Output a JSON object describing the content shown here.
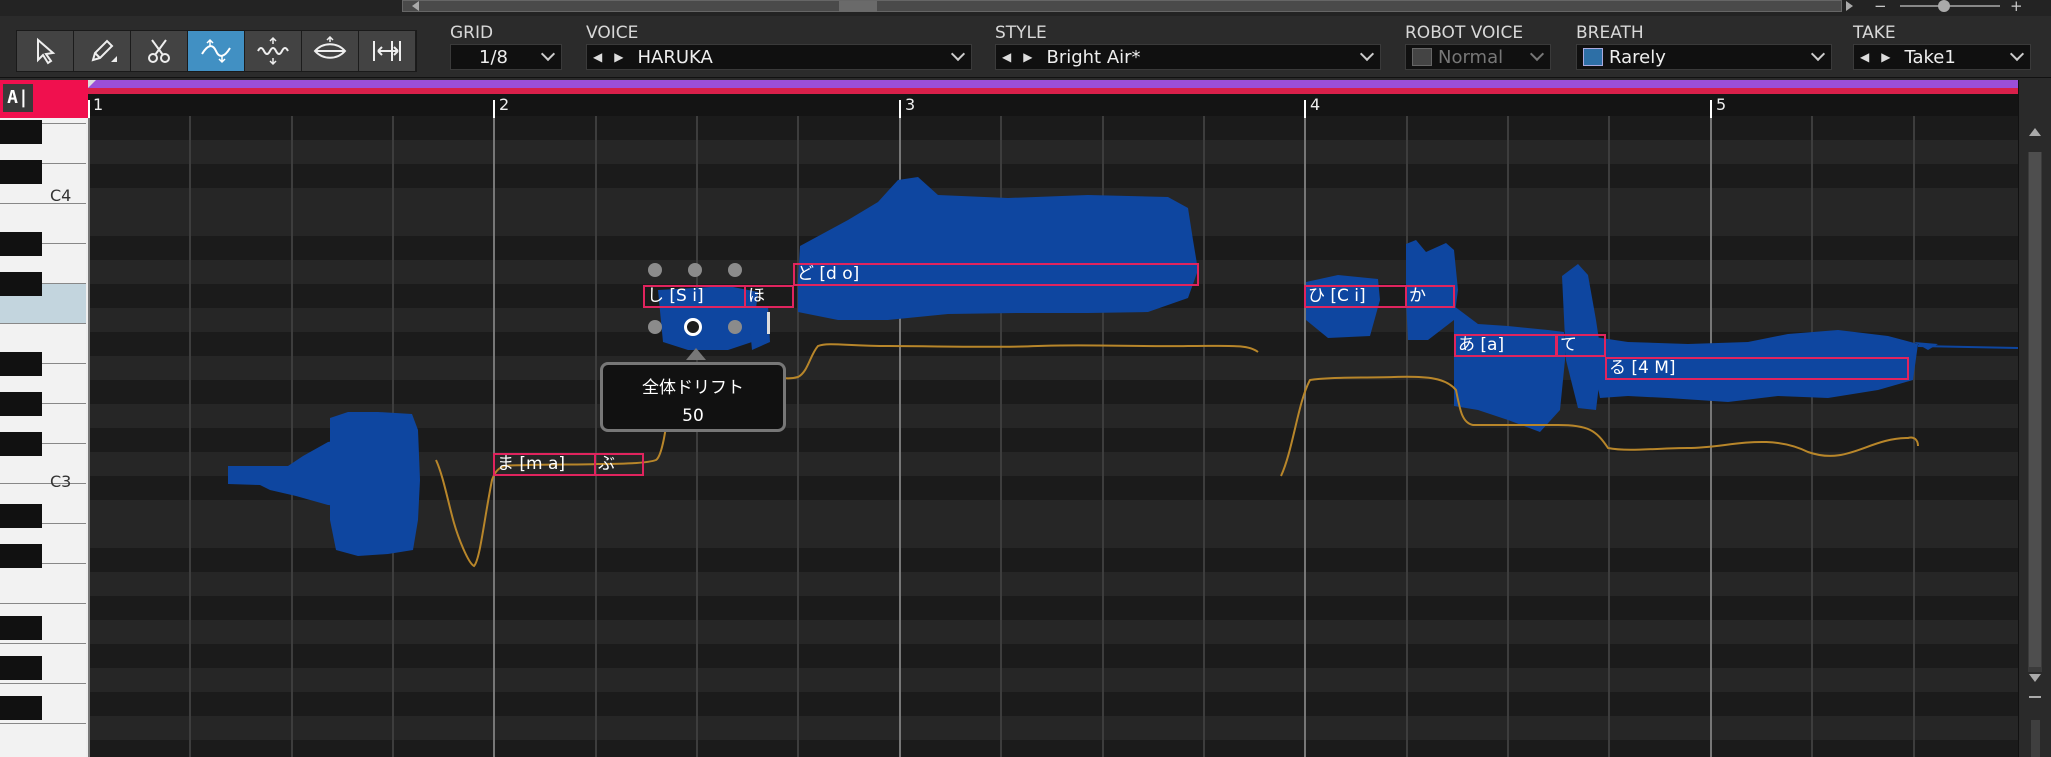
{
  "top_bar": {
    "zoom_minus": "−",
    "zoom_plus": "+"
  },
  "tools": [
    {
      "name": "pointer-tool",
      "icon": "arrow-cursor-icon",
      "active": false
    },
    {
      "name": "pencil-tool",
      "icon": "pencil-icon",
      "active": false
    },
    {
      "name": "scissors-tool",
      "icon": "scissors-icon",
      "active": false
    },
    {
      "name": "pitch-drift-tool",
      "icon": "pitch-drift-icon",
      "active": true
    },
    {
      "name": "vibrato-tool",
      "icon": "vibrato-icon",
      "active": false
    },
    {
      "name": "volume-tool",
      "icon": "volume-shape-icon",
      "active": false
    },
    {
      "name": "timing-tool",
      "icon": "timing-stretch-icon",
      "active": false
    }
  ],
  "fields": {
    "grid": {
      "label": "GRID",
      "value": "1/8"
    },
    "voice": {
      "label": "VOICE",
      "value": "HARUKA"
    },
    "style": {
      "label": "STYLE",
      "value": "Bright Air*"
    },
    "robot_voice": {
      "label": "ROBOT VOICE",
      "value": "Normal"
    },
    "breath": {
      "label": "BREATH",
      "value": "Rarely"
    },
    "take": {
      "label": "TAKE",
      "value": "Take1"
    }
  },
  "ai_badge": "A|",
  "piano_labels": {
    "c4": "C4",
    "c3": "C3"
  },
  "bars": [
    "1",
    "2",
    "3",
    "4",
    "5"
  ],
  "notes": [
    {
      "id": "ma",
      "text": "ま [m a]"
    },
    {
      "id": "bu",
      "text": "ぶ"
    },
    {
      "id": "shi",
      "text": "し [S i]"
    },
    {
      "id": "ho",
      "text": "ほ"
    },
    {
      "id": "do",
      "text": "ど [d o]"
    },
    {
      "id": "hi",
      "text": "ひ [C i]"
    },
    {
      "id": "ka",
      "text": "か"
    },
    {
      "id": "a",
      "text": "あ [a]"
    },
    {
      "id": "te",
      "text": "て"
    },
    {
      "id": "ru",
      "text": "る [4 M]"
    }
  ],
  "tooltip": {
    "title": "全体ドリフト",
    "value": "50"
  },
  "colors": {
    "accent": "#4190c3",
    "waveform": "#0e46a0",
    "note_border": "#e0245e",
    "pitch_curve": "#b8862a",
    "ai_badge": "#f0104e"
  }
}
